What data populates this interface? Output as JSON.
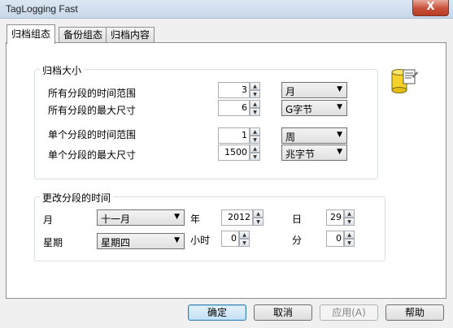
{
  "window": {
    "title": "TagLogging Fast",
    "close_label": "X"
  },
  "tabs": [
    {
      "label": "归档组态",
      "active": true
    },
    {
      "label": "备份组态",
      "active": false
    },
    {
      "label": "归档内容",
      "active": false
    }
  ],
  "archive_size": {
    "title": "归档大小",
    "rows": [
      {
        "label": "所有分段的时间范围",
        "value": "3",
        "unit": "月"
      },
      {
        "label": "所有分段的最大尺寸",
        "value": "6",
        "unit": "G字节"
      },
      {
        "label": "单个分段的时间范围",
        "value": "1",
        "unit": "周"
      },
      {
        "label": "单个分段的最大尺寸",
        "value": "1500",
        "unit": "兆字节"
      }
    ]
  },
  "segment_time": {
    "title": "更改分段的时间",
    "month_label": "月",
    "month_value": "十一月",
    "year_label": "年",
    "year_value": "2012",
    "day_label": "日",
    "day_value": "29",
    "weekday_label": "星期",
    "weekday_value": "星期四",
    "hour_label": "小时",
    "hour_value": "0",
    "minute_label": "分",
    "minute_value": "0"
  },
  "buttons": {
    "ok": "确定",
    "cancel": "取消",
    "apply": "应用(A)",
    "help": "帮助"
  }
}
